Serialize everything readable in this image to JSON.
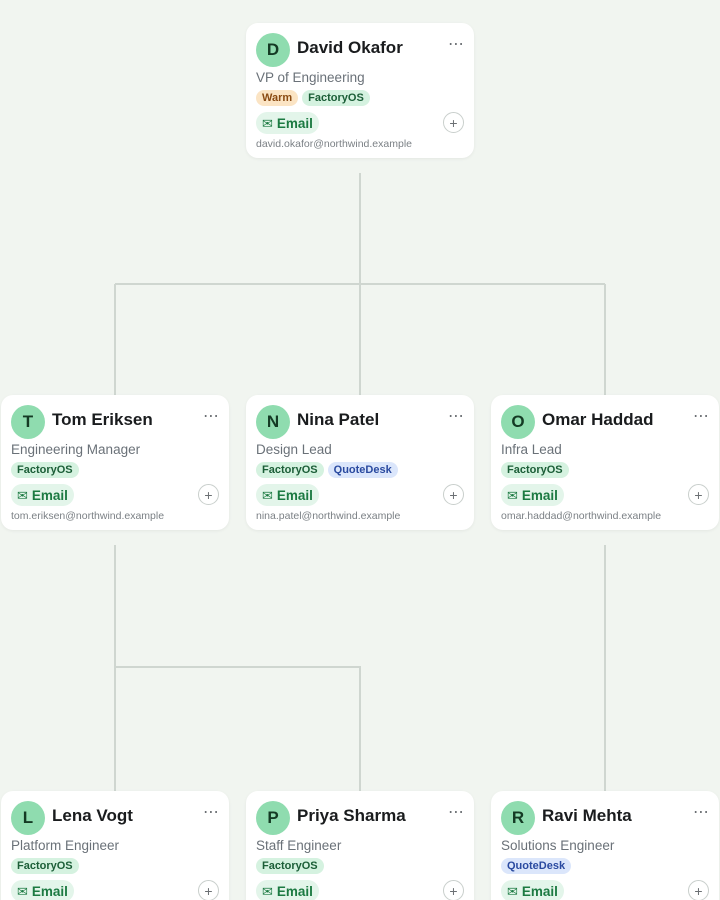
{
  "people": [
    {
      "id": "david",
      "initial": "D",
      "name": "David Okafor",
      "role": "VP of Engineering",
      "tags": [
        {
          "label": "Warm",
          "kind": "warm"
        },
        {
          "label": "FactoryOS",
          "kind": "factoryos"
        }
      ],
      "email_label": "Email",
      "email": "david.okafor@northwind.example"
    },
    {
      "id": "tom",
      "initial": "T",
      "name": "Tom Eriksen",
      "role": "Engineering Manager",
      "tags": [
        {
          "label": "FactoryOS",
          "kind": "factoryos"
        }
      ],
      "email_label": "Email",
      "email": "tom.eriksen@northwind.example"
    },
    {
      "id": "nina",
      "initial": "N",
      "name": "Nina Patel",
      "role": "Design Lead",
      "tags": [
        {
          "label": "FactoryOS",
          "kind": "factoryos"
        },
        {
          "label": "QuoteDesk",
          "kind": "quotedesk"
        }
      ],
      "email_label": "Email",
      "email": "nina.patel@northwind.example"
    },
    {
      "id": "omar",
      "initial": "O",
      "name": "Omar Haddad",
      "role": "Infra Lead",
      "tags": [
        {
          "label": "FactoryOS",
          "kind": "factoryos"
        }
      ],
      "email_label": "Email",
      "email": "omar.haddad@northwind.example"
    },
    {
      "id": "lena",
      "initial": "L",
      "name": "Lena Vogt",
      "role": "Platform Engineer",
      "tags": [
        {
          "label": "FactoryOS",
          "kind": "factoryos"
        }
      ],
      "email_label": "Email",
      "email": ""
    },
    {
      "id": "priya",
      "initial": "P",
      "name": "Priya Sharma",
      "role": "Staff Engineer",
      "tags": [
        {
          "label": "FactoryOS",
          "kind": "factoryos"
        }
      ],
      "email_label": "Email",
      "email": ""
    },
    {
      "id": "ravi",
      "initial": "R",
      "name": "Ravi Mehta",
      "role": "Solutions Engineer",
      "tags": [
        {
          "label": "QuoteDesk",
          "kind": "quotedesk"
        }
      ],
      "email_label": "Email",
      "email": ""
    }
  ],
  "icons": {
    "more": "more-horizontal-icon",
    "mail": "mail-icon",
    "add": "plus-icon"
  },
  "colors": {
    "avatar": "#8fdcaf",
    "email_button": "#e3f5ea",
    "connector": "#cfd6d0"
  }
}
